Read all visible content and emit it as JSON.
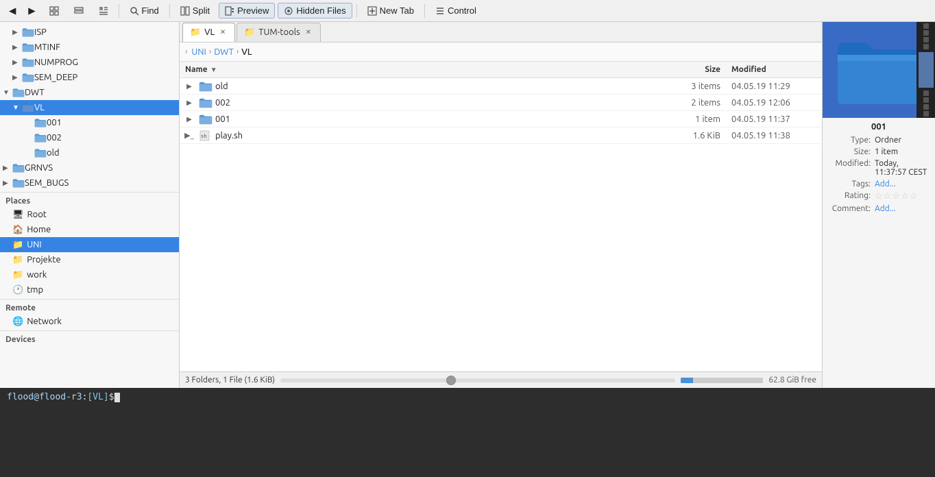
{
  "toolbar": {
    "back_label": "◀",
    "forward_label": "▶",
    "view_grid_label": "⊞",
    "view_list_label": "☰",
    "view_detail_label": "▦",
    "find_label": "Find",
    "split_label": "Split",
    "preview_label": "Preview",
    "hidden_files_label": "Hidden Files",
    "new_tab_label": "New Tab",
    "control_label": "Control"
  },
  "tabs": [
    {
      "id": "vl",
      "label": "VL",
      "active": true,
      "closable": true
    },
    {
      "id": "tum-tools",
      "label": "TUM-tools",
      "active": false,
      "closable": true
    }
  ],
  "breadcrumb": [
    {
      "label": "UNI",
      "link": true
    },
    {
      "label": "DWT",
      "link": true
    },
    {
      "label": "VL",
      "link": false
    }
  ],
  "file_list": {
    "columns": {
      "name": "Name",
      "size": "Size",
      "modified": "Modified"
    },
    "items": [
      {
        "name": "old",
        "type": "folder",
        "size": "3 items",
        "modified": "04.05.19 11:29",
        "expandable": true
      },
      {
        "name": "002",
        "type": "folder",
        "size": "2 items",
        "modified": "04.05.19 12:06",
        "expandable": true
      },
      {
        "name": "001",
        "type": "folder",
        "size": "1 item",
        "modified": "04.05.19 11:37",
        "expandable": true
      },
      {
        "name": "play.sh",
        "type": "script",
        "size": "1.6 KiB",
        "modified": "04.05.19 11:38",
        "expandable": true
      }
    ]
  },
  "status_bar": {
    "text": "3 Folders, 1 File (1.6 KiB)",
    "free_space": "62.8 GiB free"
  },
  "sidebar": {
    "tree": [
      {
        "label": "ISP",
        "indent": 1,
        "arrow": "▶",
        "type": "folder"
      },
      {
        "label": "MTINF",
        "indent": 1,
        "arrow": "▶",
        "type": "folder"
      },
      {
        "label": "NUMPROG",
        "indent": 1,
        "arrow": "▶",
        "type": "folder"
      },
      {
        "label": "SEM_DEEP",
        "indent": 1,
        "arrow": "▶",
        "type": "folder"
      },
      {
        "label": "DWT",
        "indent": 0,
        "arrow": "▼",
        "type": "folder-open"
      },
      {
        "label": "VL",
        "indent": 1,
        "arrow": "▼",
        "type": "folder-open",
        "selected": true
      },
      {
        "label": "001",
        "indent": 2,
        "arrow": "",
        "type": "folder"
      },
      {
        "label": "002",
        "indent": 2,
        "arrow": "",
        "type": "folder"
      },
      {
        "label": "old",
        "indent": 2,
        "arrow": "",
        "type": "folder"
      },
      {
        "label": "GRNVS",
        "indent": 0,
        "arrow": "▶",
        "type": "folder"
      },
      {
        "label": "SEM_BUGS",
        "indent": 0,
        "arrow": "▶",
        "type": "folder"
      }
    ],
    "places_section": "Places",
    "places": [
      {
        "label": "Root",
        "icon": "root-icon",
        "selected": false
      },
      {
        "label": "Home",
        "icon": "home-icon",
        "selected": false
      },
      {
        "label": "UNI",
        "icon": "folder-icon",
        "selected": true
      },
      {
        "label": "Projekte",
        "icon": "folder-icon",
        "selected": false
      },
      {
        "label": "work",
        "icon": "folder-icon",
        "selected": false
      },
      {
        "label": "tmp",
        "icon": "clock-icon",
        "selected": false
      }
    ],
    "remote_section": "Remote",
    "remote": [
      {
        "label": "Network",
        "icon": "network-icon",
        "selected": false
      }
    ],
    "devices_section": "Devices",
    "devices": []
  },
  "preview": {
    "title": "001",
    "type_label": "Type:",
    "type_value": "Ordner",
    "size_label": "Size:",
    "size_value": "1 item",
    "modified_label": "Modified:",
    "modified_value": "Today, 11:37:57 CEST",
    "tags_label": "Tags:",
    "tags_link": "Add...",
    "rating_label": "Rating:",
    "rating_stars": "★★★★★",
    "comment_label": "Comment:",
    "comment_link": "Add..."
  },
  "terminal": {
    "user": "flood",
    "host": "flood-r3",
    "path": "[VL]",
    "prompt_char": "$"
  }
}
